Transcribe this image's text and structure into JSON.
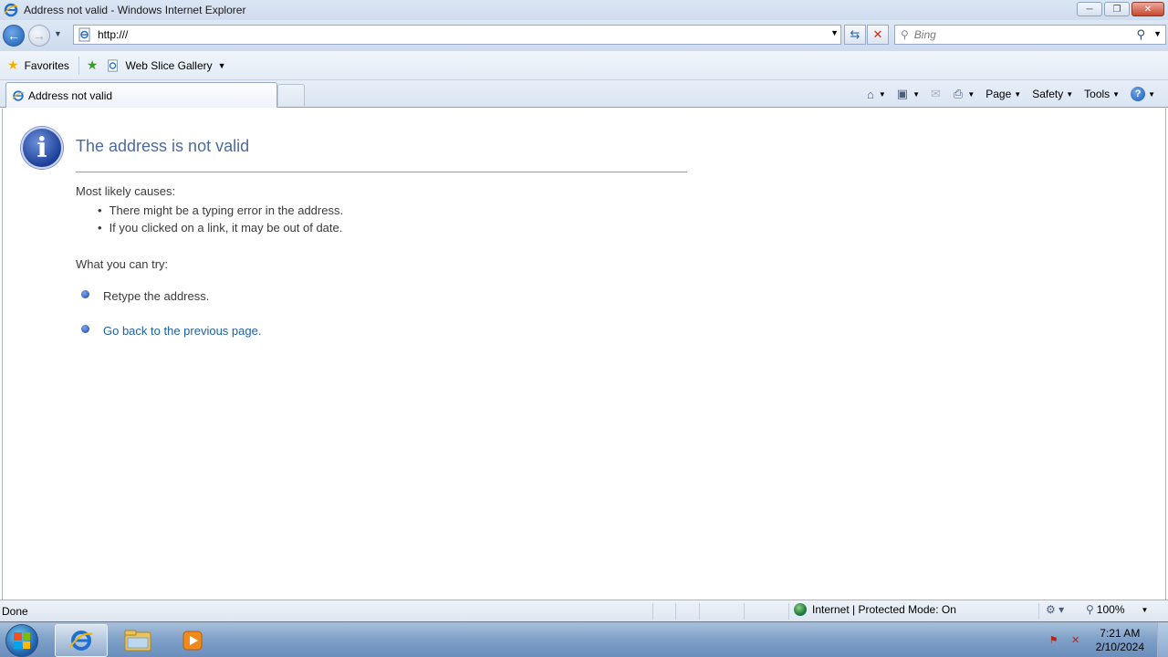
{
  "window": {
    "title": "Address not valid - Windows Internet Explorer",
    "controls": {
      "minimize": "─",
      "restore": "❐",
      "close": "✕"
    }
  },
  "address": {
    "url": "http:///",
    "search_placeholder": "Bing"
  },
  "favorites_bar": {
    "favorites_label": "Favorites",
    "web_slice_label": "Web Slice Gallery"
  },
  "tabs": [
    {
      "label": "Address not valid",
      "active": true
    }
  ],
  "command_bar": {
    "page_label": "Page",
    "safety_label": "Safety",
    "tools_label": "Tools"
  },
  "error_page": {
    "title": "The address is not valid",
    "causes_heading": "Most likely causes:",
    "causes": [
      "There might be a typing error in the address.",
      "If you clicked on a link, it may be out of date."
    ],
    "try_heading": "What you can try:",
    "try_items": [
      {
        "text": "Retype the address.",
        "link": false
      },
      {
        "text": "Go back to the previous page.",
        "link": true
      }
    ]
  },
  "status_bar": {
    "status": "Done",
    "zone": "Internet | Protected Mode: On",
    "zoom": "100%"
  },
  "taskbar": {
    "time": "7:21 AM",
    "date": "2/10/2024"
  },
  "colors": {
    "accent": "#1f5fa8",
    "error_title": "#4b6b9d"
  }
}
